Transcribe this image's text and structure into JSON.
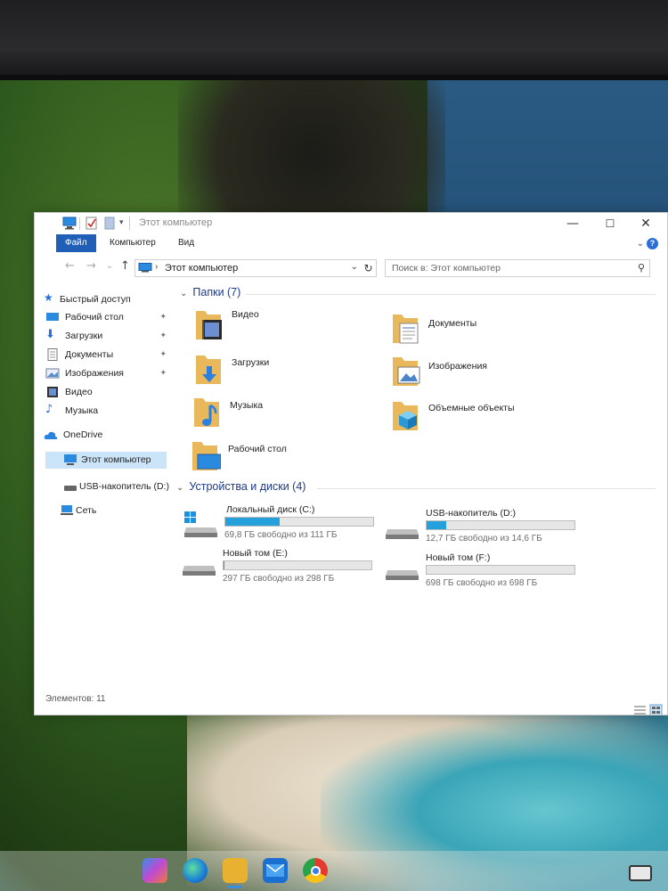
{
  "window": {
    "title": "Этот компьютер",
    "minimize_glyph": "—",
    "maximize_glyph": "☐",
    "close_glyph": "✕"
  },
  "ribbon": {
    "tabs": [
      "Файл",
      "Компьютер",
      "Вид"
    ],
    "expand_glyph": "⌄",
    "help_glyph": "?"
  },
  "address": {
    "back_glyph": "←",
    "forward_glyph": "→",
    "recent_glyph": "⌄",
    "up_glyph": "↑",
    "separator": "›",
    "path": "Этот компьютер",
    "dropdown_glyph": "⌄",
    "refresh_glyph": "↻"
  },
  "search": {
    "placeholder": "Поиск в: Этот компьютер",
    "icon": "search-icon"
  },
  "nav": {
    "quick_access": "Быстрый доступ",
    "pinned": [
      {
        "label": "Рабочий стол",
        "icon": "desktop-icon"
      },
      {
        "label": "Загрузки",
        "icon": "downloads-icon"
      },
      {
        "label": "Документы",
        "icon": "documents-icon"
      },
      {
        "label": "Изображения",
        "icon": "pictures-icon"
      }
    ],
    "recent": [
      {
        "label": "Видео",
        "icon": "video-icon"
      },
      {
        "label": "Музыка",
        "icon": "music-icon"
      }
    ],
    "onedrive": "OneDrive",
    "this_pc": "Этот компьютер",
    "usb": "USB-накопитель (D:)",
    "network": "Сеть",
    "pin_glyph": "📌"
  },
  "folders_group": {
    "title": "Папки (7)",
    "items": [
      {
        "label": "Видео",
        "icon": "video-folder-icon"
      },
      {
        "label": "Документы",
        "icon": "documents-folder-icon"
      },
      {
        "label": "Загрузки",
        "icon": "downloads-folder-icon"
      },
      {
        "label": "Изображения",
        "icon": "pictures-folder-icon"
      },
      {
        "label": "Музыка",
        "icon": "music-folder-icon"
      },
      {
        "label": "Объемные объекты",
        "icon": "3d-objects-folder-icon"
      },
      {
        "label": "Рабочий стол",
        "icon": "desktop-folder-icon"
      }
    ]
  },
  "drives_group": {
    "title": "Устройства и диски (4)",
    "items": [
      {
        "name": "Локальный диск (C:)",
        "free": "69,8 ГБ свободно из 111 ГБ",
        "used_fraction": 0.37
      },
      {
        "name": "USB-накопитель (D:)",
        "free": "12,7 ГБ свободно из 14,6 ГБ",
        "used_fraction": 0.13
      },
      {
        "name": "Новый том (E:)",
        "free": "297 ГБ свободно из 298 ГБ",
        "used_fraction": 0.003
      },
      {
        "name": "Новый том (F:)",
        "free": "698 ГБ свободно из 698 ГБ",
        "used_fraction": 0.0
      }
    ]
  },
  "status": {
    "items_count": "Элементов: 11"
  },
  "colors": {
    "accent": "#1f5fb8",
    "drive_bar": "#26a0da",
    "group_title": "#1e3a8a",
    "selected_bg": "#cce4f7"
  },
  "taskbar": {
    "apps": [
      "copilot-icon",
      "edge-icon",
      "file-explorer-icon",
      "mail-icon",
      "chrome-icon"
    ]
  }
}
